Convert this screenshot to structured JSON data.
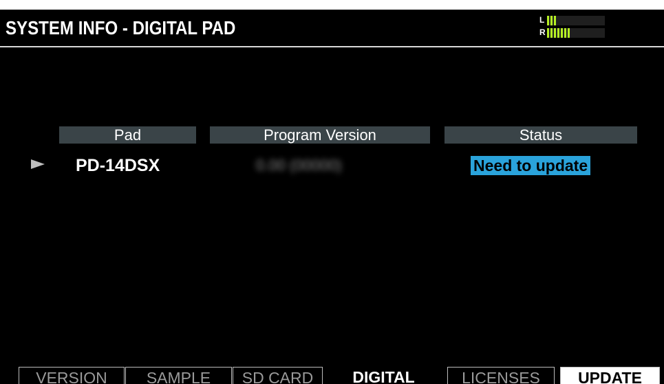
{
  "header": {
    "title": "SYSTEM INFO - DIGITAL PAD",
    "meter": {
      "left_label": "L",
      "right_label": "R",
      "left_level": 0.16,
      "right_level": 0.42,
      "meter_color": "#b5ee24"
    }
  },
  "table": {
    "columns": [
      "Pad",
      "Program Version",
      "Status"
    ],
    "rows": [
      {
        "pad": "PD-14DSX",
        "version": "0.00 (00000)",
        "status": "Need to update",
        "selected": true
      }
    ]
  },
  "tabs": [
    {
      "label": "VERSION",
      "state": "normal"
    },
    {
      "label": "SAMPLE",
      "state": "normal"
    },
    {
      "label": "SD CARD",
      "state": "normal"
    },
    {
      "label": "DIGITAL",
      "state": "active"
    },
    {
      "label": "LICENSES",
      "state": "normal"
    },
    {
      "label": "UPDATE",
      "state": "highlight"
    }
  ],
  "colors": {
    "background": "#000000",
    "header_cell": "#3a4448",
    "status_badge": "#2aa3db",
    "selection_arrow": "#bdbdbd"
  },
  "icons": {
    "row_cursor": "triangle-right-icon"
  }
}
